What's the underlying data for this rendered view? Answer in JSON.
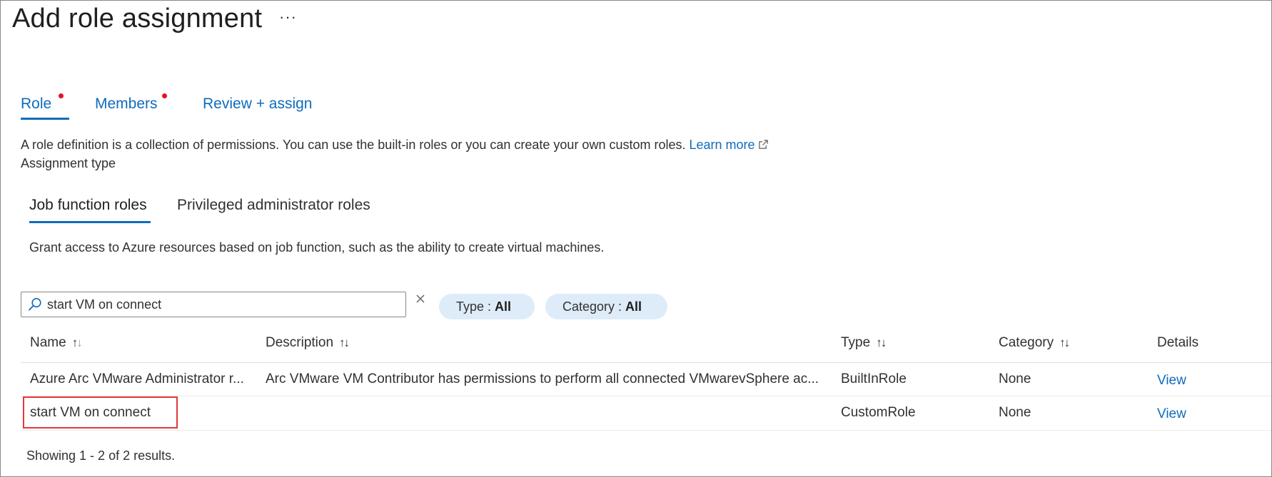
{
  "header": {
    "title": "Add role assignment",
    "more": "···"
  },
  "tabs": [
    {
      "label": "Role",
      "required": true,
      "active": true
    },
    {
      "label": "Members",
      "required": true,
      "active": false
    },
    {
      "label": "Review + assign",
      "required": false,
      "active": false
    }
  ],
  "intro": {
    "text": "A role definition is a collection of permissions. You can use the built-in roles or you can create your own custom roles.",
    "learn_more": "Learn more"
  },
  "assignment_type_label": "Assignment type",
  "subtabs": [
    {
      "label": "Job function roles",
      "active": true
    },
    {
      "label": "Privileged administrator roles",
      "active": false
    }
  ],
  "grant_text": "Grant access to Azure resources based on job function, such as the ability to create virtual machines.",
  "search": {
    "value": "start VM on connect",
    "placeholder": ""
  },
  "filters": {
    "type": {
      "label": "Type : ",
      "value": "All"
    },
    "category": {
      "label": "Category : ",
      "value": "All"
    }
  },
  "table": {
    "columns": [
      "Name",
      "Description",
      "Type",
      "Category",
      "Details"
    ],
    "rows": [
      {
        "name": "Azure Arc VMware Administrator r...",
        "description": "Arc VMware VM Contributor has permissions to perform all connected VMwarevSphere ac...",
        "type": "BuiltInRole",
        "category": "None",
        "details": "View"
      },
      {
        "name": "start VM on connect",
        "description": "",
        "type": "CustomRole",
        "category": "None",
        "details": "View"
      }
    ]
  },
  "footer": "Showing 1 - 2 of 2 results.",
  "colors": {
    "accent": "#0f6cbd",
    "required_dot": "#e81123",
    "highlight_border": "#e03a3a",
    "pill_bg": "#deecf9"
  }
}
